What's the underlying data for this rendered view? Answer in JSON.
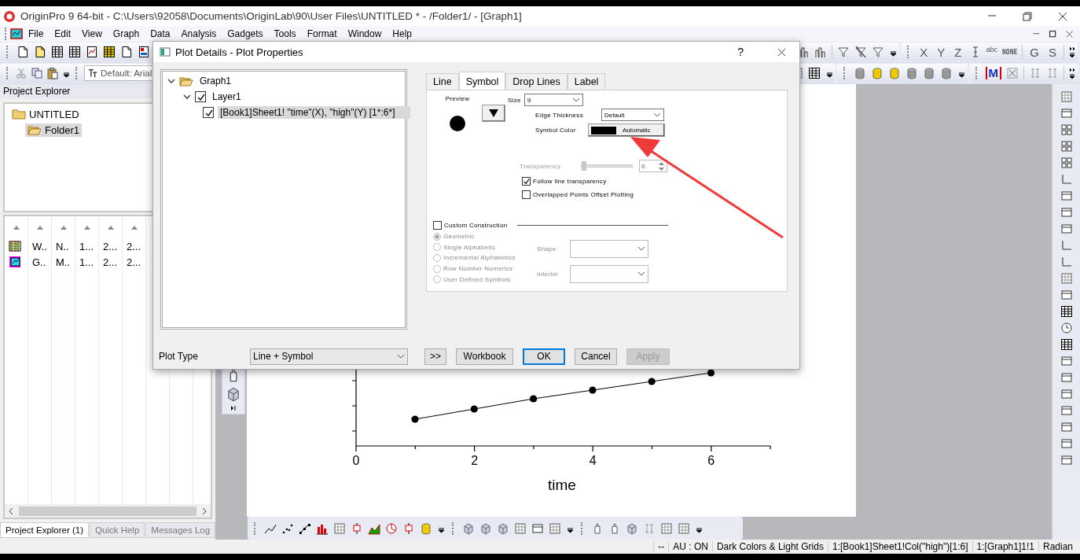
{
  "window": {
    "title": "OriginPro 9 64-bit - C:\\Users\\92058\\Documents\\OriginLab\\90\\User Files\\UNTITLED * - /Folder1/ - [Graph1]"
  },
  "menu": [
    "File",
    "Edit",
    "View",
    "Graph",
    "Data",
    "Analysis",
    "Gadgets",
    "Tools",
    "Format",
    "Window",
    "Help"
  ],
  "toolbar": {
    "font_box": "Default: Arial",
    "axis_buttons": [
      "X",
      "Y",
      "Z"
    ],
    "label_button": "abc",
    "none_button": "NONE",
    "group_buttons": [
      "G",
      "S"
    ],
    "mask_button": "M"
  },
  "project_explorer": {
    "title": "Project Explorer",
    "folders": [
      {
        "label": "UNTITLED",
        "selected": false,
        "children": [
          {
            "label": "Folder1",
            "selected": true
          }
        ]
      }
    ],
    "rows": [
      {
        "kind": "workbook",
        "cells": [
          "W..",
          "N..",
          "1...",
          "2...",
          "2..."
        ]
      },
      {
        "kind": "graph",
        "cells": [
          "G..",
          "M..",
          "1...",
          "2...",
          "2..."
        ]
      }
    ],
    "tabs": [
      {
        "label": "Project Explorer (1)",
        "selected": true
      },
      {
        "label": "Quick Help",
        "selected": false
      },
      {
        "label": "Messages Log",
        "selected": false
      }
    ]
  },
  "graph": {
    "x_tick_labels": [
      "0",
      "2",
      "4",
      "6"
    ],
    "x_title": "time"
  },
  "dialog": {
    "title": "Plot Details - Plot Properties",
    "help": "?",
    "tree": [
      {
        "label": "Graph1",
        "kind": "folder",
        "expanded": true,
        "selected": false,
        "children": [
          {
            "label": "Layer1",
            "checked": true,
            "expanded": true,
            "selected": false,
            "children": [
              {
                "label": "[Book1]Sheet1! \"time\"(X), \"high\"(Y) [1*:6*]",
                "checked": true,
                "selected": true
              }
            ]
          }
        ]
      }
    ],
    "tabs": [
      {
        "label": "Line",
        "selected": false
      },
      {
        "label": "Symbol",
        "selected": true
      },
      {
        "label": "Drop Lines",
        "selected": false
      },
      {
        "label": "Label",
        "selected": false
      }
    ],
    "symbol": {
      "preview_label": "Preview",
      "size_label": "Size",
      "size": "9",
      "edge_label": "Edge Thickness",
      "edge": "Default",
      "color_label": "Symbol Color",
      "color": "#000000",
      "color_text": "Automatic",
      "transparency_label": "Transparency",
      "transparency_disabled": true,
      "transparency": {
        "level": 0
      },
      "transparency_value": "0",
      "checks": [
        {
          "label": "Follow line transparency",
          "checked": true
        },
        {
          "label": "Overlapped Points Offset Plotting",
          "checked": false
        }
      ],
      "custom": {
        "label": "Custom Construction",
        "checked": false
      },
      "radios": [
        {
          "label": "Geometric",
          "selected": true,
          "disabled": true
        },
        {
          "label": "Single Alphabetic",
          "selected": false,
          "disabled": true
        },
        {
          "label": "Incremental Alphabetics",
          "selected": false,
          "disabled": true
        },
        {
          "label": "Row Number Numerics",
          "selected": false,
          "disabled": true
        },
        {
          "label": "User Defined Symbols",
          "selected": false,
          "disabled": true
        }
      ],
      "shape_label": "Shape",
      "interior_label": "Interior"
    },
    "plot_type_label": "Plot Type",
    "plot_type": "Line + Symbol",
    "buttons": [
      {
        "label": ">>",
        "default": false,
        "disabled": false
      },
      {
        "label": "Workbook",
        "default": false,
        "disabled": false
      },
      {
        "label": "OK",
        "default": true,
        "disabled": false
      },
      {
        "label": "Cancel",
        "default": false,
        "disabled": false
      },
      {
        "label": "Apply",
        "default": false,
        "disabled": true
      }
    ]
  },
  "status_bar": [
    "--",
    "AU : ON",
    "Dark Colors & Light Grids",
    "1:[Book1]Sheet1!Col(\"high\")[1:6]",
    "1:[Graph1]1!1",
    "Radian"
  ]
}
